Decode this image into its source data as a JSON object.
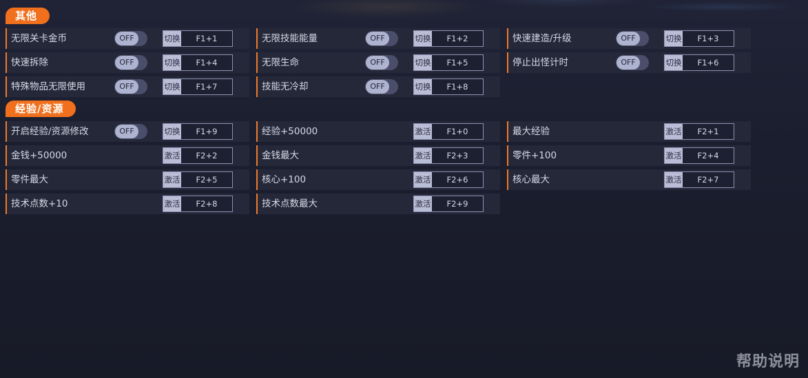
{
  "sections": [
    {
      "title": "其他",
      "rows": [
        [
          {
            "label": "无限关卡金币",
            "toggle": "OFF",
            "mode": "切换",
            "hotkey": "F1+1"
          },
          {
            "label": "无限技能能量",
            "toggle": "OFF",
            "mode": "切换",
            "hotkey": "F1+2"
          },
          {
            "label": "快速建造/升级",
            "toggle": "OFF",
            "mode": "切换",
            "hotkey": "F1+3"
          }
        ],
        [
          {
            "label": "快速拆除",
            "toggle": "OFF",
            "mode": "切换",
            "hotkey": "F1+4"
          },
          {
            "label": "无限生命",
            "toggle": "OFF",
            "mode": "切换",
            "hotkey": "F1+5"
          },
          {
            "label": "停止出怪计时",
            "toggle": "OFF",
            "mode": "切换",
            "hotkey": "F1+6"
          }
        ],
        [
          {
            "label": "特殊物品无限使用",
            "toggle": "OFF",
            "mode": "切换",
            "hotkey": "F1+7"
          },
          {
            "label": "技能无冷却",
            "toggle": "OFF",
            "mode": "切换",
            "hotkey": "F1+8"
          }
        ]
      ]
    },
    {
      "title": "经验/资源",
      "rows": [
        [
          {
            "label": "开启经验/资源修改",
            "toggle": "OFF",
            "mode": "切换",
            "hotkey": "F1+9"
          },
          {
            "label": "经验+50000",
            "mode": "激活",
            "hotkey": "F1+0"
          },
          {
            "label": "最大经验",
            "mode": "激活",
            "hotkey": "F2+1"
          }
        ],
        [
          {
            "label": "金钱+50000",
            "mode": "激活",
            "hotkey": "F2+2"
          },
          {
            "label": "金钱最大",
            "mode": "激活",
            "hotkey": "F2+3"
          },
          {
            "label": "零件+100",
            "mode": "激活",
            "hotkey": "F2+4"
          }
        ],
        [
          {
            "label": "零件最大",
            "mode": "激活",
            "hotkey": "F2+5"
          },
          {
            "label": "核心+100",
            "mode": "激活",
            "hotkey": "F2+6"
          },
          {
            "label": "核心最大",
            "mode": "激活",
            "hotkey": "F2+7"
          }
        ],
        [
          {
            "label": "技术点数+10",
            "mode": "激活",
            "hotkey": "F2+8"
          },
          {
            "label": "技术点数最大",
            "mode": "激活",
            "hotkey": "F2+9"
          }
        ]
      ]
    }
  ],
  "help_label": "帮助说明",
  "colors": {
    "accent": "#f0701e",
    "row_bg": "#252838",
    "toggle_knob": "#aeb3cf"
  }
}
